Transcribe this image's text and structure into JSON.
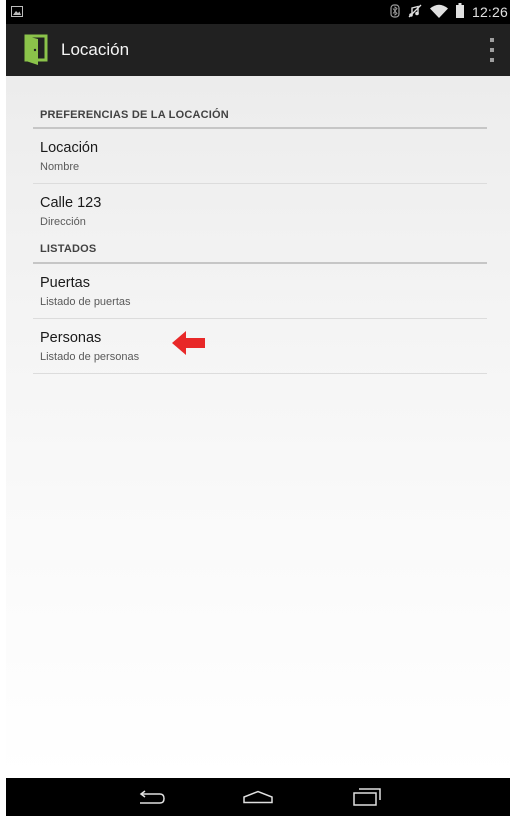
{
  "status_bar": {
    "time": "12:26",
    "icons": [
      "image-notification-icon",
      "bluetooth-icon",
      "muted-icon",
      "wifi-icon",
      "battery-icon"
    ]
  },
  "action_bar": {
    "title": "Locación",
    "icon": "door-app-icon",
    "overflow_icon": "overflow-menu-icon"
  },
  "preferences": {
    "category_location": "PREFERENCIAS DE LA LOCACIÓN",
    "items_location": [
      {
        "title": "Locación",
        "summary": "Nombre"
      },
      {
        "title": "Calle 123",
        "summary": "Dirección"
      }
    ],
    "category_lists": "LISTADOS",
    "items_lists": [
      {
        "title": "Puertas",
        "summary": "Listado de puertas"
      },
      {
        "title": "Personas",
        "summary": "Listado de personas"
      }
    ]
  },
  "annotation": {
    "arrow_icon": "red-arrow-icon",
    "arrow_color": "#e82828"
  },
  "nav_bar": {
    "buttons": [
      "back-icon",
      "home-icon",
      "recent-apps-icon"
    ]
  },
  "colors": {
    "action_bar": "#212121",
    "app_icon_green": "#8bc34a",
    "divider": "#c6c6c6"
  }
}
